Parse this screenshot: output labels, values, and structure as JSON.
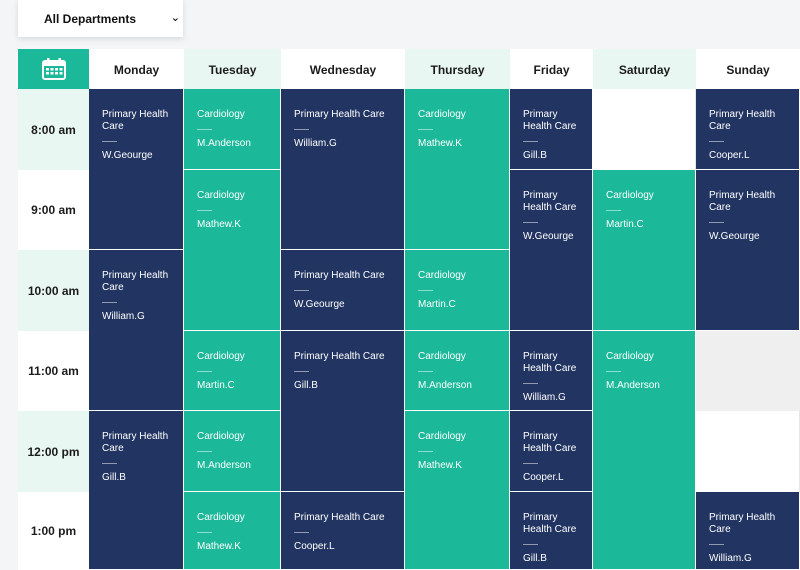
{
  "filter": {
    "selected": "All Departments"
  },
  "days": [
    "Monday",
    "Tuesday",
    "Wednesday",
    "Thursday",
    "Friday",
    "Saturday",
    "Sunday"
  ],
  "times": [
    "8:00 am",
    "9:00 am",
    "10:00 am",
    "11:00 am",
    "12:00 pm",
    "1:00 pm"
  ],
  "events": [
    {
      "dept": "Primary Health Care",
      "doctor": "W.Geourge"
    },
    {
      "dept": "Primary Health Care",
      "doctor": "William.G"
    },
    {
      "dept": "Primary Health Care",
      "doctor": "Gill.B"
    },
    {
      "dept": "Cardiology",
      "doctor": "M.Anderson"
    },
    {
      "dept": "Cardiology",
      "doctor": "Mathew.K"
    },
    {
      "dept": "Cardiology",
      "doctor": "Martin.C"
    },
    {
      "dept": "Cardiology",
      "doctor": "M.Anderson"
    },
    {
      "dept": "Cardiology",
      "doctor": "Mathew.K"
    },
    {
      "dept": "Primary Health Care",
      "doctor": "William.G"
    },
    {
      "dept": "Primary Health Care",
      "doctor": "W.Geourge"
    },
    {
      "dept": "Primary Health Care",
      "doctor": "Gill.B"
    },
    {
      "dept": "Primary Health Care",
      "doctor": "Cooper.L"
    },
    {
      "dept": "Cardiology",
      "doctor": "Mathew.K"
    },
    {
      "dept": "Cardiology",
      "doctor": "Martin.C"
    },
    {
      "dept": "Cardiology",
      "doctor": "M.Anderson"
    },
    {
      "dept": "Cardiology",
      "doctor": "Mathew.K"
    },
    {
      "dept": "Primary Health Care",
      "doctor": "Gill.B"
    },
    {
      "dept": "Primary Health Care",
      "doctor": "W.Geourge"
    },
    {
      "dept": "Primary Health Care",
      "doctor": "William.G"
    },
    {
      "dept": "Primary Health Care",
      "doctor": "Cooper.L"
    },
    {
      "dept": "Primary Health Care",
      "doctor": "Gill.B"
    },
    {
      "dept": "Cardiology",
      "doctor": "Martin.C"
    },
    {
      "dept": "Cardiology",
      "doctor": "M.Anderson"
    },
    {
      "dept": "Primary Health Care",
      "doctor": "Cooper.L"
    },
    {
      "dept": "Primary Health Care",
      "doctor": "W.Geourge"
    },
    {
      "dept": "Primary Health Care",
      "doctor": "William.G"
    }
  ],
  "colors": {
    "navy": "#223461",
    "teal": "#1bb99a",
    "tint": "#e8f7f2"
  }
}
